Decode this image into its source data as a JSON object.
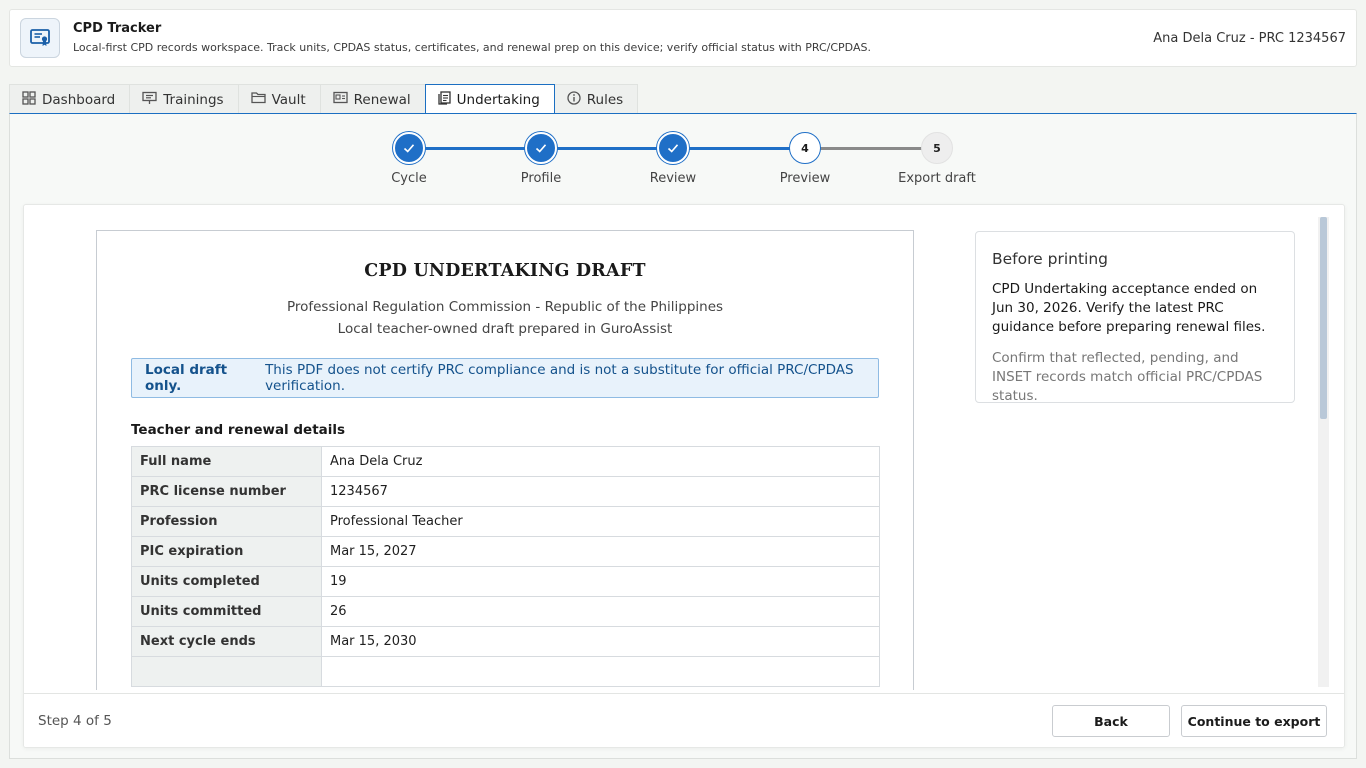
{
  "app": {
    "title": "CPD Tracker",
    "subtitle": "Local-first CPD records workspace. Track units, CPDAS status, certificates, and renewal prep on this device; verify official status with PRC/CPDAS.",
    "user": "Ana Dela Cruz - PRC 1234567",
    "icon": "certificate-icon",
    "accent_color": "#1f6fc7"
  },
  "tabs": [
    {
      "label": "Dashboard",
      "icon": "grid-icon",
      "active": false
    },
    {
      "label": "Trainings",
      "icon": "presentation-icon",
      "active": false
    },
    {
      "label": "Vault",
      "icon": "folder-icon",
      "active": false
    },
    {
      "label": "Renewal",
      "icon": "id-card-icon",
      "active": false
    },
    {
      "label": "Undertaking",
      "icon": "document-icon",
      "active": true
    },
    {
      "label": "Rules",
      "icon": "info-icon",
      "active": false
    }
  ],
  "stepper": {
    "steps": [
      {
        "label": "Cycle",
        "number": "1",
        "state": "done"
      },
      {
        "label": "Profile",
        "number": "2",
        "state": "done"
      },
      {
        "label": "Review",
        "number": "3",
        "state": "done"
      },
      {
        "label": "Preview",
        "number": "4",
        "state": "current"
      },
      {
        "label": "Export draft",
        "number": "5",
        "state": "todo"
      }
    ]
  },
  "document": {
    "title": "CPD UNDERTAKING DRAFT",
    "organization": "Professional Regulation Commission - Republic of the Philippines",
    "prepared": "Local teacher-owned draft prepared in GuroAssist",
    "notice_strong": "Local draft only.",
    "notice_text": "This PDF does not certify PRC compliance and is not a substitute for official PRC/CPDAS verification.",
    "section_title": "Teacher and renewal details",
    "rows": [
      {
        "key": "Full name",
        "value": "Ana Dela Cruz"
      },
      {
        "key": "PRC license number",
        "value": "1234567"
      },
      {
        "key": "Profession",
        "value": "Professional Teacher"
      },
      {
        "key": "PIC expiration",
        "value": "Mar 15, 2027"
      },
      {
        "key": "Units completed",
        "value": "19"
      },
      {
        "key": "Units committed",
        "value": "26"
      },
      {
        "key": "Next cycle ends",
        "value": "Mar 15, 2030"
      }
    ]
  },
  "side_panel": {
    "title": "Before printing",
    "body": "CPD Undertaking acceptance ended on Jun 30, 2026. Verify the latest PRC guidance before preparing renewal files.",
    "note": "Confirm that reflected, pending, and INSET records match official PRC/CPDAS status."
  },
  "footer": {
    "step_count": "Step 4 of 5",
    "back_label": "Back",
    "continue_label": "Continue to export"
  }
}
